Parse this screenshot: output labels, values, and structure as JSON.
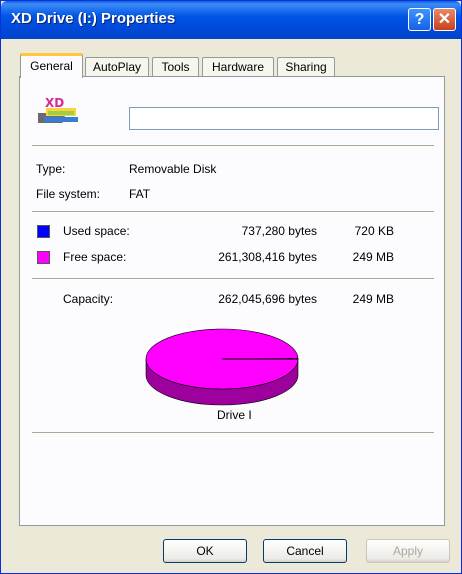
{
  "window": {
    "title": "XD Drive (I:) Properties"
  },
  "titlebar_buttons": {
    "help": "?",
    "close": "✕"
  },
  "tabs": [
    {
      "label": "General"
    },
    {
      "label": "AutoPlay"
    },
    {
      "label": "Tools"
    },
    {
      "label": "Hardware"
    },
    {
      "label": "Sharing"
    }
  ],
  "general": {
    "icon_text": "XD",
    "drive_name_value": "",
    "type_label": "Type:",
    "type_value": "Removable Disk",
    "filesystem_label": "File system:",
    "filesystem_value": "FAT",
    "used": {
      "label": "Used space:",
      "bytes": "737,280 bytes",
      "size": "720 KB",
      "color": "#0000ff"
    },
    "free": {
      "label": "Free space:",
      "bytes": "261,308,416 bytes",
      "size": "249 MB",
      "color": "#ff00ff"
    },
    "capacity": {
      "label": "Capacity:",
      "bytes": "262,045,696 bytes",
      "size": "249 MB"
    },
    "drive_label": "Drive I"
  },
  "chart_data": {
    "type": "pie",
    "slices": [
      {
        "label": "Used space",
        "value": 737280,
        "color": "#0000ff"
      },
      {
        "label": "Free space",
        "value": 261308416,
        "color": "#ff00ff"
      }
    ]
  },
  "buttons": {
    "ok": "OK",
    "cancel": "Cancel",
    "apply": "Apply"
  }
}
